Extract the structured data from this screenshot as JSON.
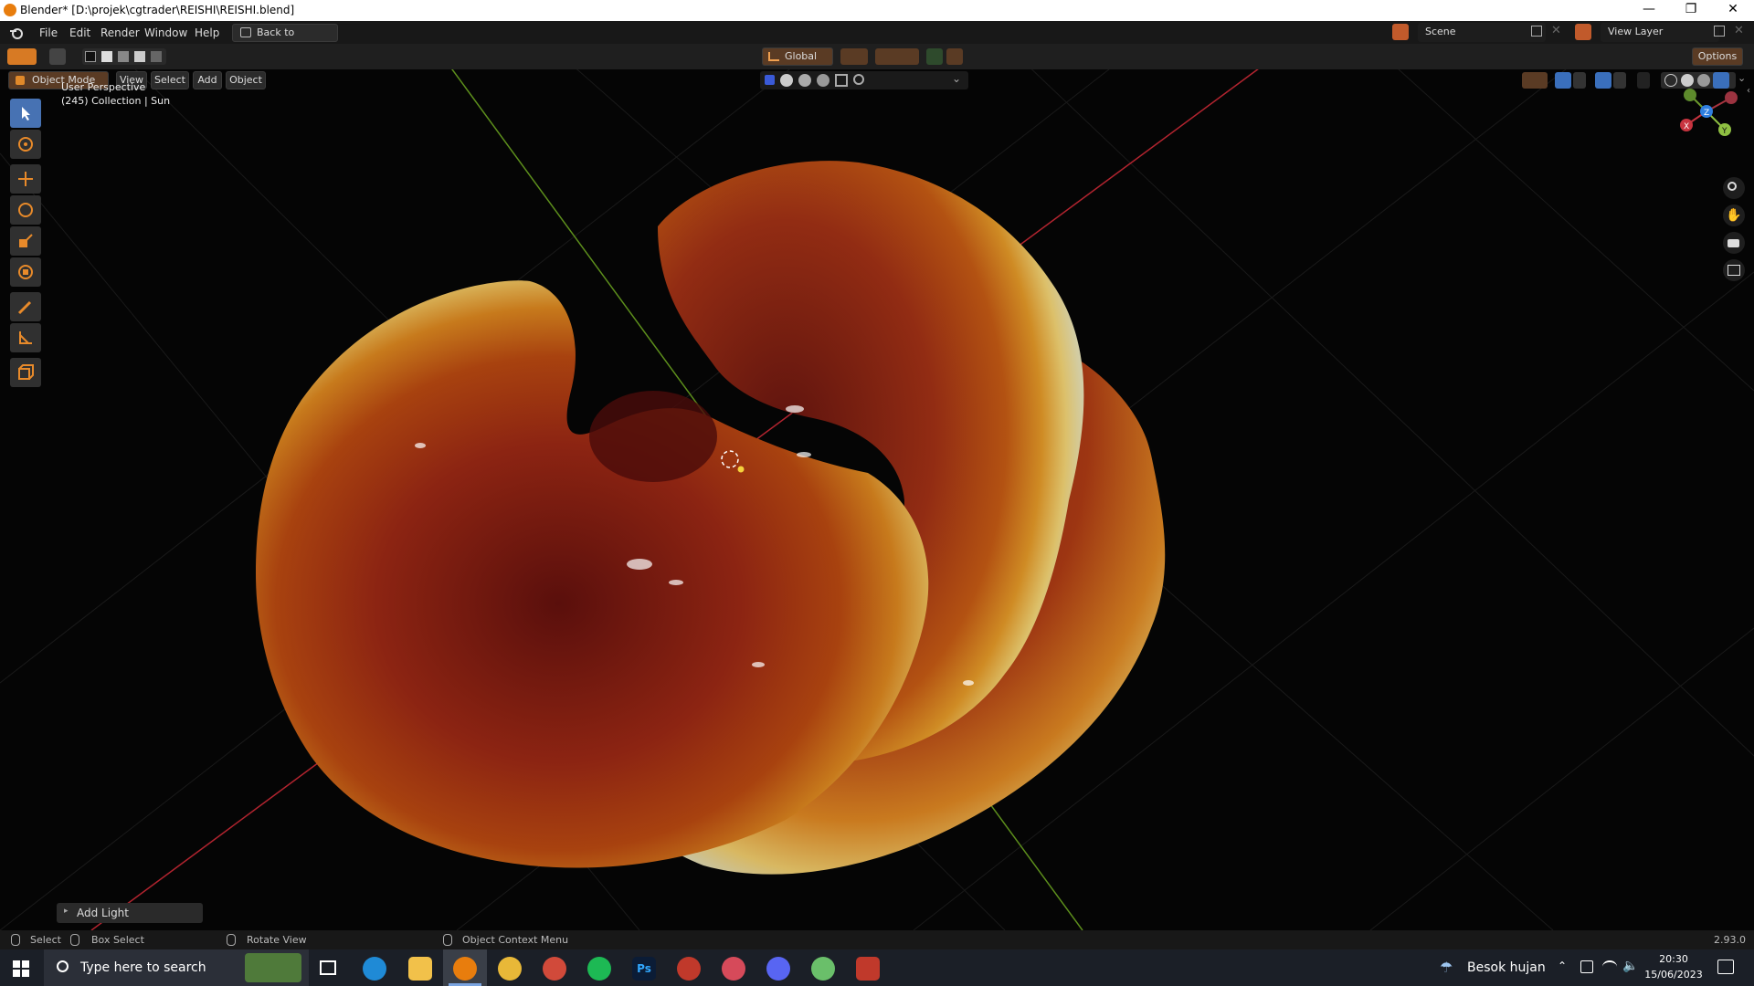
{
  "window": {
    "title": "Blender* [D:\\projek\\cgtrader\\REISHI\\REISHI.blend]",
    "minimize": "—",
    "maximize": "❐",
    "close": "✕"
  },
  "menu": {
    "file": "File",
    "edit": "Edit",
    "render": "Render",
    "window": "Window",
    "help": "Help",
    "back_to_previous": "Back to Previous",
    "scene": "Scene",
    "view_layer": "View Layer"
  },
  "tool_header": {
    "orientation": "Global",
    "options": "Options"
  },
  "view_header": {
    "mode": "Object Mode",
    "view": "View",
    "select": "Select",
    "add": "Add",
    "object": "Object"
  },
  "viewport": {
    "perspective": "User Perspective",
    "collection_info": "(245) Collection | Sun",
    "operator_panel": "Add Light",
    "gizmo": {
      "x": "X",
      "y": "Y",
      "z": "Z"
    }
  },
  "statusbar": {
    "select": "Select",
    "box_select": "Box Select",
    "rotate_view": "Rotate View",
    "context_menu": "Object Context Menu",
    "version": "2.93.0"
  },
  "taskbar": {
    "search_placeholder": "Type here to search",
    "weather": "Besok hujan",
    "time": "20:30",
    "date": "15/06/2023",
    "ps_label": "Ps"
  },
  "colors": {
    "accent_blue": "#4772b3",
    "blender_orange": "#e87d0d",
    "axis_x": "#c8343f",
    "axis_y": "#6c9a2c",
    "axis_z": "#2f7fe0"
  }
}
